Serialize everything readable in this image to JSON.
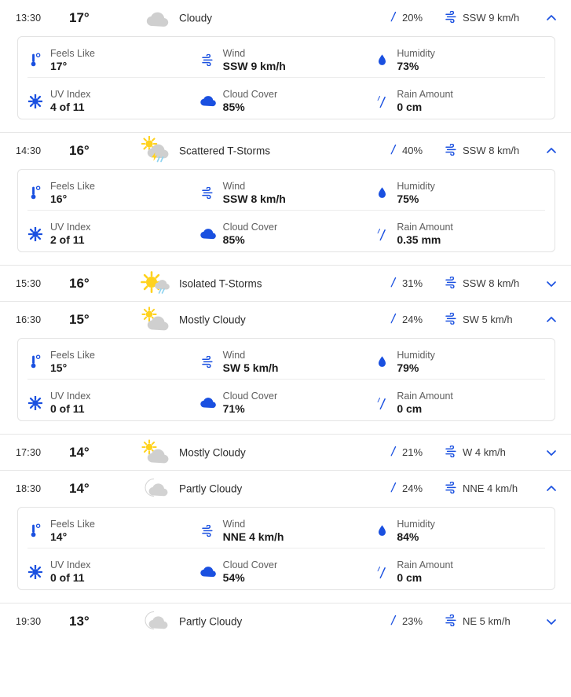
{
  "labels": {
    "feels_like": "Feels Like",
    "wind": "Wind",
    "humidity": "Humidity",
    "uv_index": "UV Index",
    "cloud_cover": "Cloud Cover",
    "rain_amount": "Rain Amount"
  },
  "colors": {
    "accent_blue": "#1a50e0",
    "sun_yellow": "#ffd21e",
    "cloud_grey": "#cfcfcf",
    "divider": "#e6e6e6"
  },
  "icons": {
    "precip": "raindrop-icon",
    "wind": "wind-icon",
    "chevron_up": "chevron-up-icon",
    "chevron_down": "chevron-down-icon",
    "feels_like": "thermometer-icon",
    "wind_detail": "wind-icon",
    "humidity": "water-droplet-icon",
    "uv_index": "sun-uv-icon",
    "cloud_cover": "cloud-icon",
    "rain_amount": "rain-droplet-icon"
  },
  "hours": [
    {
      "time": "13:30",
      "temp": "17°",
      "condition": "Cloudy",
      "condition_icon": "cloudy",
      "precip": "20%",
      "wind": "SSW 9 km/h",
      "expanded": true,
      "details": {
        "feels_like": "17°",
        "wind": "SSW 9 km/h",
        "humidity": "73%",
        "uv_index": "4 of 11",
        "cloud_cover": "85%",
        "rain_amount": "0 cm"
      }
    },
    {
      "time": "14:30",
      "temp": "16°",
      "condition": "Scattered T-Storms",
      "condition_icon": "scattered-tstorms",
      "precip": "40%",
      "wind": "SSW 8 km/h",
      "expanded": true,
      "details": {
        "feels_like": "16°",
        "wind": "SSW 8 km/h",
        "humidity": "75%",
        "uv_index": "2 of 11",
        "cloud_cover": "85%",
        "rain_amount": "0.35 mm"
      }
    },
    {
      "time": "15:30",
      "temp": "16°",
      "condition": "Isolated T-Storms",
      "condition_icon": "isolated-tstorms",
      "precip": "31%",
      "wind": "SSW 8 km/h",
      "expanded": false,
      "details": null
    },
    {
      "time": "16:30",
      "temp": "15°",
      "condition": "Mostly Cloudy",
      "condition_icon": "mostly-cloudy",
      "precip": "24%",
      "wind": "SW 5 km/h",
      "expanded": true,
      "details": {
        "feels_like": "15°",
        "wind": "SW 5 km/h",
        "humidity": "79%",
        "uv_index": "0 of 11",
        "cloud_cover": "71%",
        "rain_amount": "0 cm"
      }
    },
    {
      "time": "17:30",
      "temp": "14°",
      "condition": "Mostly Cloudy",
      "condition_icon": "mostly-cloudy",
      "precip": "21%",
      "wind": "W 4 km/h",
      "expanded": false,
      "details": null
    },
    {
      "time": "18:30",
      "temp": "14°",
      "condition": "Partly Cloudy",
      "condition_icon": "partly-cloudy-night",
      "precip": "24%",
      "wind": "NNE 4 km/h",
      "expanded": true,
      "details": {
        "feels_like": "14°",
        "wind": "NNE 4 km/h",
        "humidity": "84%",
        "uv_index": "0 of 11",
        "cloud_cover": "54%",
        "rain_amount": "0 cm"
      }
    },
    {
      "time": "19:30",
      "temp": "13°",
      "condition": "Partly Cloudy",
      "condition_icon": "partly-cloudy-night",
      "precip": "23%",
      "wind": "NE 5 km/h",
      "expanded": false,
      "details": null
    }
  ]
}
